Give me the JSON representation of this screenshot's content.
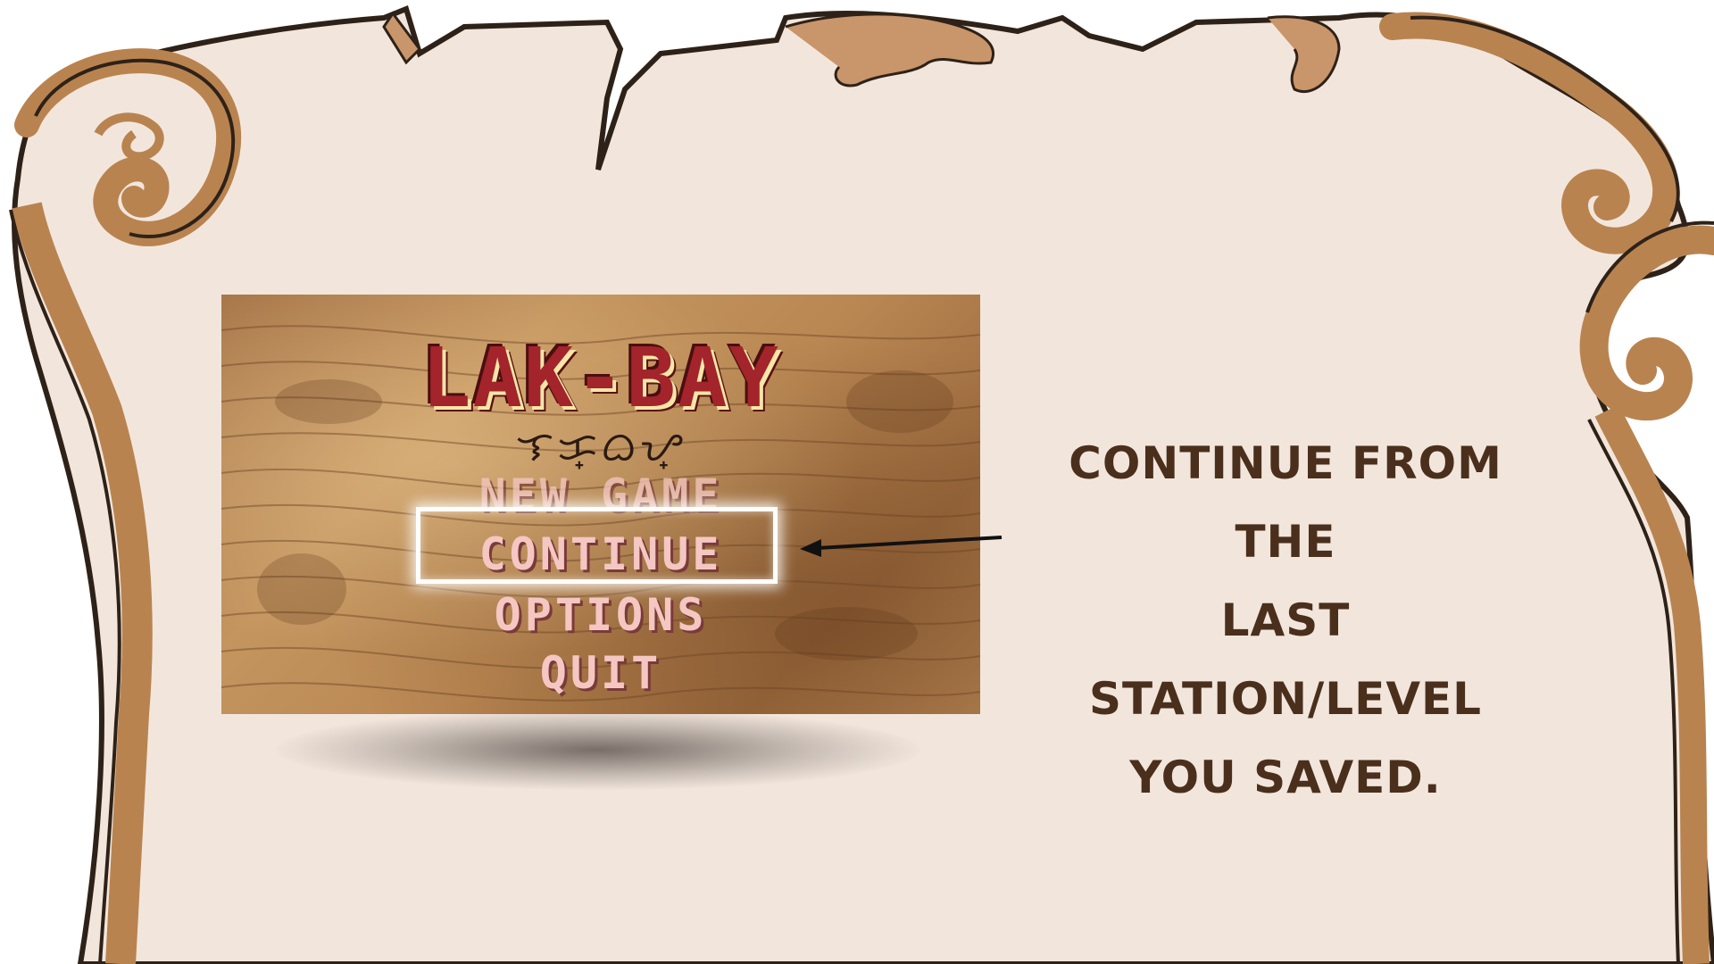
{
  "game_screen": {
    "logo_text": "LAK-BAY",
    "subtitle_script": "ᜎᜃ᜔ᜊᜌ᜔",
    "menu": {
      "new_game": "NEW GAME",
      "continue": "CONTINUE",
      "options": "OPTIONS",
      "quit": "QUIT"
    },
    "selected_item": "CONTINUE"
  },
  "caption": {
    "line1": "CONTINUE FROM THE",
    "line2": "LAST STATION/LEVEL",
    "line3": "YOU SAVED."
  },
  "colors": {
    "parchment": "#f2e6dc",
    "scroll_edge": "#b98350",
    "outline": "#3a2a1a",
    "caption_text": "#4a2f1c",
    "menu_text": "#f4c7c2",
    "logo_red": "#a3242a"
  },
  "icons": {
    "arrow": "arrow-left-icon"
  }
}
